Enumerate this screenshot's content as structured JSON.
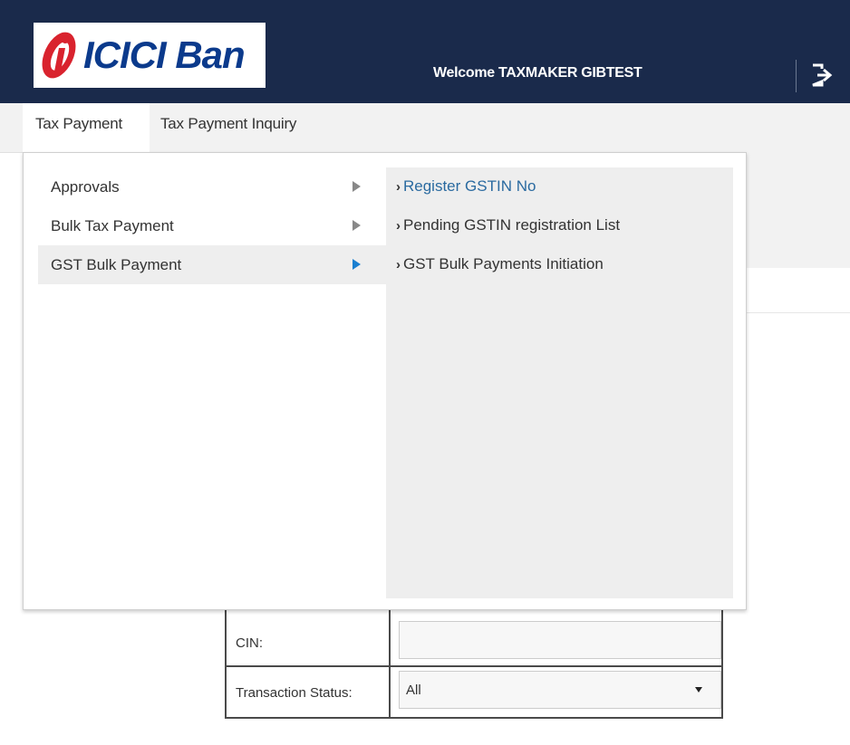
{
  "header": {
    "logo_text": "ICICI Ban",
    "welcome_label": "Welcome",
    "user_name": "TAXMAKER GIBTEST",
    "logout_icon": "logout-icon"
  },
  "nav": {
    "tabs": [
      {
        "label": "Tax Payment"
      },
      {
        "label": "Tax Payment Inquiry"
      }
    ]
  },
  "menu": {
    "items": [
      {
        "label": "Approvals"
      },
      {
        "label": "Bulk Tax Payment"
      },
      {
        "label": "GST Bulk Payment"
      }
    ],
    "submenu": [
      {
        "label": "Register GSTIN No"
      },
      {
        "label": "Pending GSTIN registration List"
      },
      {
        "label": "GST Bulk Payments Initiation"
      }
    ]
  },
  "form": {
    "cin_label": "CIN:",
    "cin_value": "",
    "status_label": "Transaction Status:",
    "status_value": "All"
  },
  "colors": {
    "header_bg": "#1a2a4b",
    "logo_blue": "#0b3a8c",
    "logo_red": "#d9232e",
    "active_arrow": "#1a7fd0",
    "link_blue": "#2a6aa0"
  }
}
